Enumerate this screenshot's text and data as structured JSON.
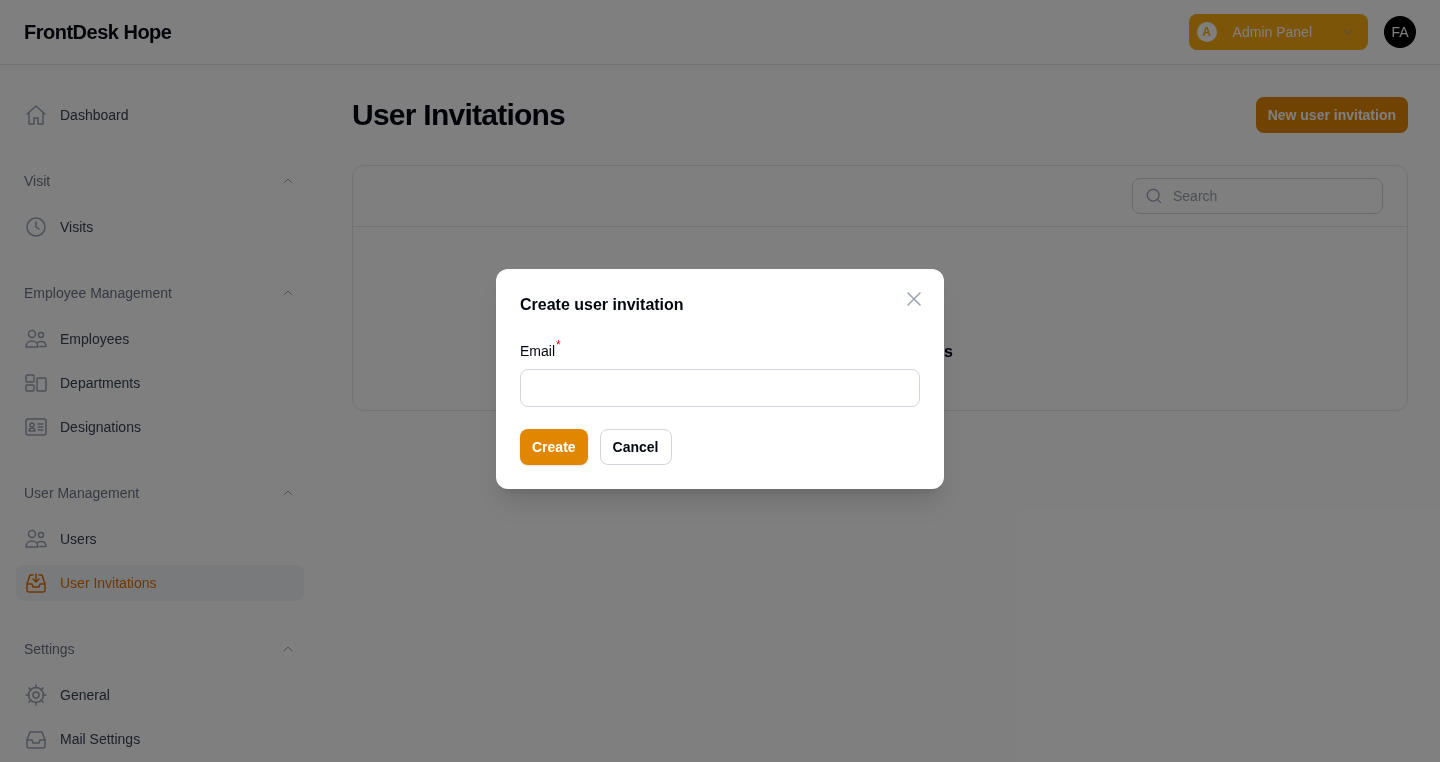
{
  "header": {
    "app_name": "FrontDesk Hope",
    "panel_switcher": {
      "badge": "A",
      "label": "Admin Panel"
    },
    "avatar": "FA"
  },
  "sidebar": [
    {
      "kind": "link",
      "label": "Dashboard",
      "selected": false
    },
    {
      "kind": "section",
      "label": "Visit",
      "expanded": true,
      "children": [
        {
          "label": "Visits",
          "selected": false
        }
      ]
    },
    {
      "kind": "section",
      "label": "Employee Management",
      "expanded": true,
      "children": [
        {
          "label": "Employees",
          "selected": false
        },
        {
          "label": "Departments",
          "selected": false
        },
        {
          "label": "Designations",
          "selected": false
        }
      ]
    },
    {
      "kind": "section",
      "label": "User Management",
      "expanded": true,
      "children": [
        {
          "label": "Users",
          "selected": false
        },
        {
          "label": "User Invitations",
          "selected": true
        }
      ]
    },
    {
      "kind": "section",
      "label": "Settings",
      "expanded": true,
      "children": [
        {
          "label": "General",
          "selected": false
        },
        {
          "label": "Mail Settings",
          "selected": false
        }
      ]
    }
  ],
  "page": {
    "title": "User Invitations",
    "action": "New user invitation",
    "search": {
      "placeholder": "Search"
    },
    "empty_state_fragment": "s"
  },
  "dialog": {
    "title": "Create user invitation",
    "field": {
      "label": "Email",
      "required_mark": "*"
    },
    "buttons": [
      {
        "label": "Create",
        "kind": "primary"
      },
      {
        "label": "Cancel",
        "kind": "secondary"
      }
    ]
  }
}
